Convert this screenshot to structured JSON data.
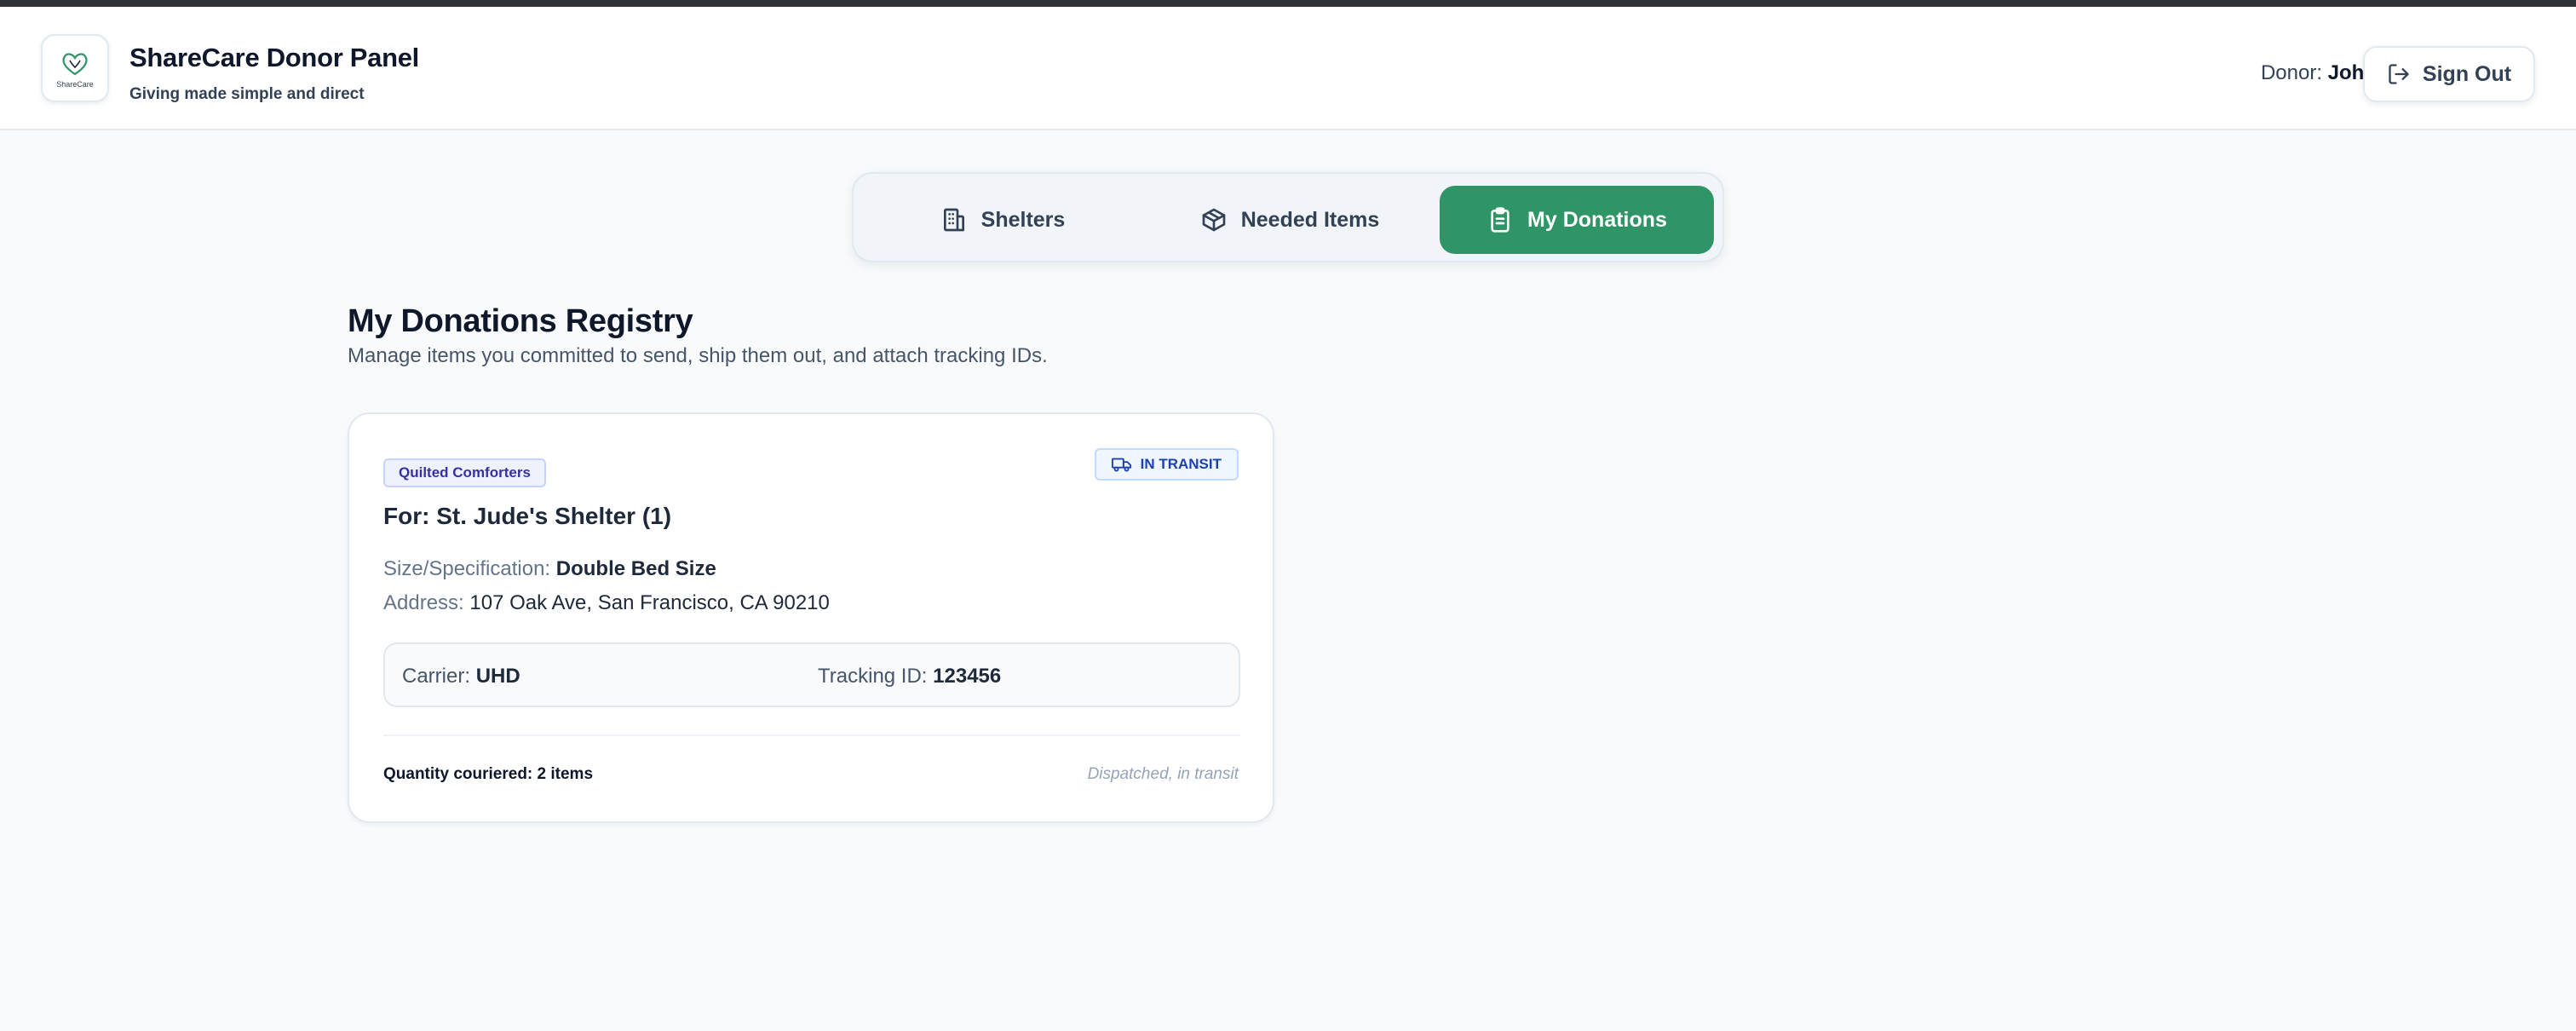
{
  "brand": {
    "logo_text": "ShareCare",
    "title": "ShareCare Donor Panel",
    "subtitle": "Giving made simple and direct"
  },
  "header": {
    "donor_label": "Donor:",
    "donor_name": "John",
    "signout_label": "Sign Out"
  },
  "tabs": [
    {
      "label": "Shelters",
      "icon": "building-icon",
      "active": false
    },
    {
      "label": "Needed Items",
      "icon": "box-icon",
      "active": true
    },
    {
      "label": "My Donations",
      "icon": "clipboard-icon",
      "active": true
    }
  ],
  "main": {
    "title": "My Donations Registry",
    "subtitle": "Manage items you committed to send, ship them out, and attach tracking IDs."
  },
  "donation": {
    "tag": "Quilted Comforters",
    "status": "IN TRANSIT",
    "for": "For: St. Jude's Shelter (1)",
    "size_label": "Size/Specification:",
    "size_value": "Double Bed Size",
    "address_label": "Address:",
    "address_value": "107 Oak Ave, San Francisco, CA 90210",
    "carrier_label": "Carrier:",
    "carrier_value": "UHD",
    "tracking_label": "Tracking ID:",
    "tracking_value": "123456",
    "quantity_label": "Quantity couriered:",
    "quantity_value": "2 items",
    "note": "Dispatched, in transit"
  },
  "colors": {
    "accent": "#2f9466",
    "status_blue": "#1e40af",
    "tag_indigo": "#3730a3"
  }
}
